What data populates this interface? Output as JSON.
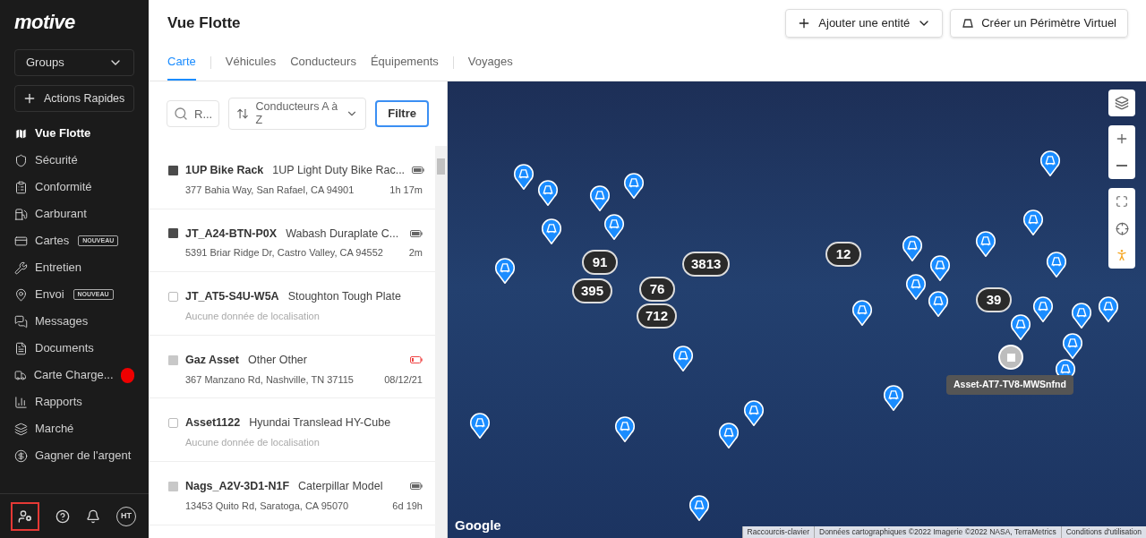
{
  "brand": "motive",
  "sidebar": {
    "groups_select": "Groups",
    "quick_actions": "Actions Rapides",
    "items": [
      {
        "label": "Vue Flotte",
        "selected": true
      },
      {
        "label": "Sécurité",
        "selected": false
      },
      {
        "label": "Conformité",
        "selected": false
      },
      {
        "label": "Carburant",
        "selected": false
      },
      {
        "label": "Cartes",
        "selected": false,
        "badge": "NOUVEAU"
      },
      {
        "label": "Entretien",
        "selected": false
      },
      {
        "label": "Envoi",
        "selected": false,
        "badge": "NOUVEAU"
      },
      {
        "label": "Messages",
        "selected": false
      },
      {
        "label": "Documents",
        "selected": false
      },
      {
        "label": "Carte Charge...",
        "selected": false,
        "alert": true
      },
      {
        "label": "Rapports",
        "selected": false
      },
      {
        "label": "Marché",
        "selected": false
      },
      {
        "label": "Gagner de l'argent",
        "selected": false
      }
    ],
    "footer": {
      "avatar": "HT"
    }
  },
  "header": {
    "title": "Vue Flotte",
    "add_button": "Ajouter une entité",
    "geofence_button": "Créer un Périmètre Virtuel"
  },
  "tabs": [
    {
      "label": "Carte",
      "selected": true
    },
    {
      "label": "Véhicules",
      "selected": false
    },
    {
      "label": "Conducteurs",
      "selected": false
    },
    {
      "label": "Équipements",
      "selected": false
    },
    {
      "label": "Voyages",
      "selected": false
    }
  ],
  "list": {
    "search": {
      "placeholder": "R..."
    },
    "sort": "Conducteurs A à Z",
    "filter_button": "Filtre",
    "items": [
      {
        "name": "1UP Bike Rack",
        "model": "1UP Light Duty Bike Rac...",
        "kind": "filled",
        "color": "#4b4b4b",
        "battery_low": false,
        "location": "377 Bahia Way, San Rafael, CA 94901",
        "time": "1h 17m"
      },
      {
        "name": "JT_A24-BTN-P0X",
        "model": "Wabash Duraplate C...",
        "kind": "filled",
        "color": "#4b4b4b",
        "battery_low": false,
        "location": "5391 Briar Ridge Dr, Castro Valley, CA 94552",
        "time": "2m"
      },
      {
        "name": "JT_AT5-S4U-W5A",
        "model": "Stoughton Tough Plate",
        "kind": "outline",
        "note": "Aucune donnée de localisation"
      },
      {
        "name": "Gaz Asset",
        "model": "Other Other",
        "kind": "filled",
        "color": "#c8c8c8",
        "battery_low": true,
        "location": "367 Manzano Rd, Nashville, TN 37115",
        "time": "08/12/21"
      },
      {
        "name": "Asset1122",
        "model": "Hyundai Translead HY-Cube",
        "kind": "outline",
        "note": "Aucune donnée de localisation"
      },
      {
        "name": "Nags_A2V-3D1-N1F",
        "model": "Caterpillar Model",
        "kind": "filled",
        "color": "#c8c8c8",
        "battery_low": false,
        "location": "13453 Quito Rd, Saratoga, CA 95070",
        "time": "6d 19h"
      }
    ]
  },
  "map": {
    "clusters": [
      {
        "count": "91"
      },
      {
        "count": "3813"
      },
      {
        "count": "12"
      },
      {
        "count": "395"
      },
      {
        "count": "76"
      },
      {
        "count": "712"
      },
      {
        "count": "39"
      }
    ],
    "tooltip": "Asset-AT7-TV8-MWSnfnd",
    "logo": "Google",
    "attribution": [
      "Raccourcis-clavier",
      "Données cartographiques ©2022 Imagerie ©2022 NASA, TerraMetrics",
      "Conditions d'utilisation"
    ]
  }
}
